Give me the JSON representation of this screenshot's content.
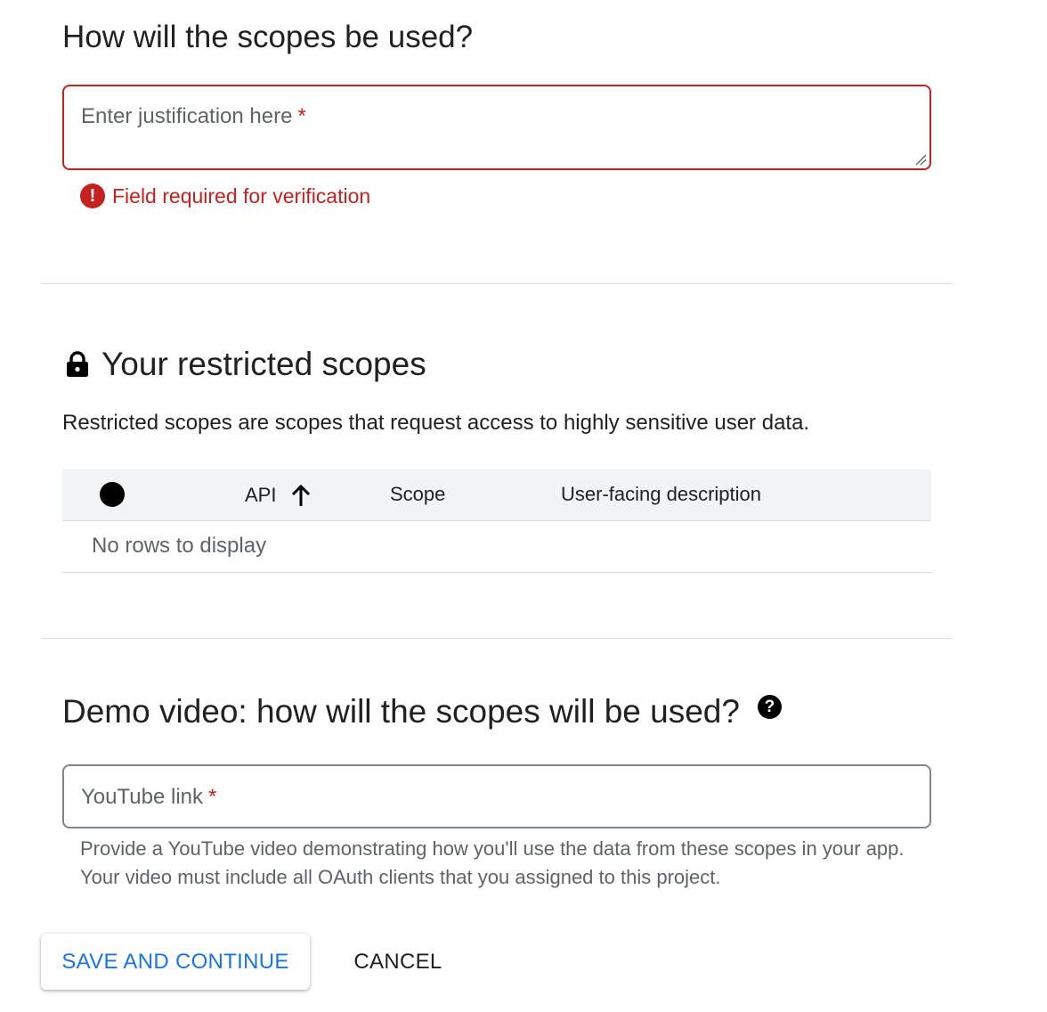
{
  "usage_section": {
    "heading": "How will the scopes be used?",
    "justification_label": "Enter justification here",
    "required_mark": "*",
    "error_text": "Field required for verification",
    "error_icon_glyph": "!"
  },
  "restricted_section": {
    "heading": "Your restricted scopes",
    "description": "Restricted scopes are scopes that request access to highly sensitive user data.",
    "table": {
      "columns": [
        "API",
        "Scope",
        "User-facing description"
      ],
      "sort_column": "API",
      "sort_direction": "ascending",
      "empty_text": "No rows to display"
    }
  },
  "demo_section": {
    "heading": "Demo video: how will the scopes will be used?",
    "help_icon_glyph": "?",
    "youtube_label": "YouTube link",
    "required_mark": "*",
    "helper_text": "Provide a YouTube video demonstrating how you'll use the data from these scopes in your app. Your video must include all OAuth clients that you assigned to this project."
  },
  "actions": {
    "save_label": "SAVE AND CONTINUE",
    "cancel_label": "CANCEL"
  },
  "colors": {
    "error": "#c5221f",
    "primary": "#1a73e8",
    "text": "#202124",
    "muted": "#5f6368",
    "divider": "#dadce0",
    "table_header_bg": "#f1f3f4"
  }
}
